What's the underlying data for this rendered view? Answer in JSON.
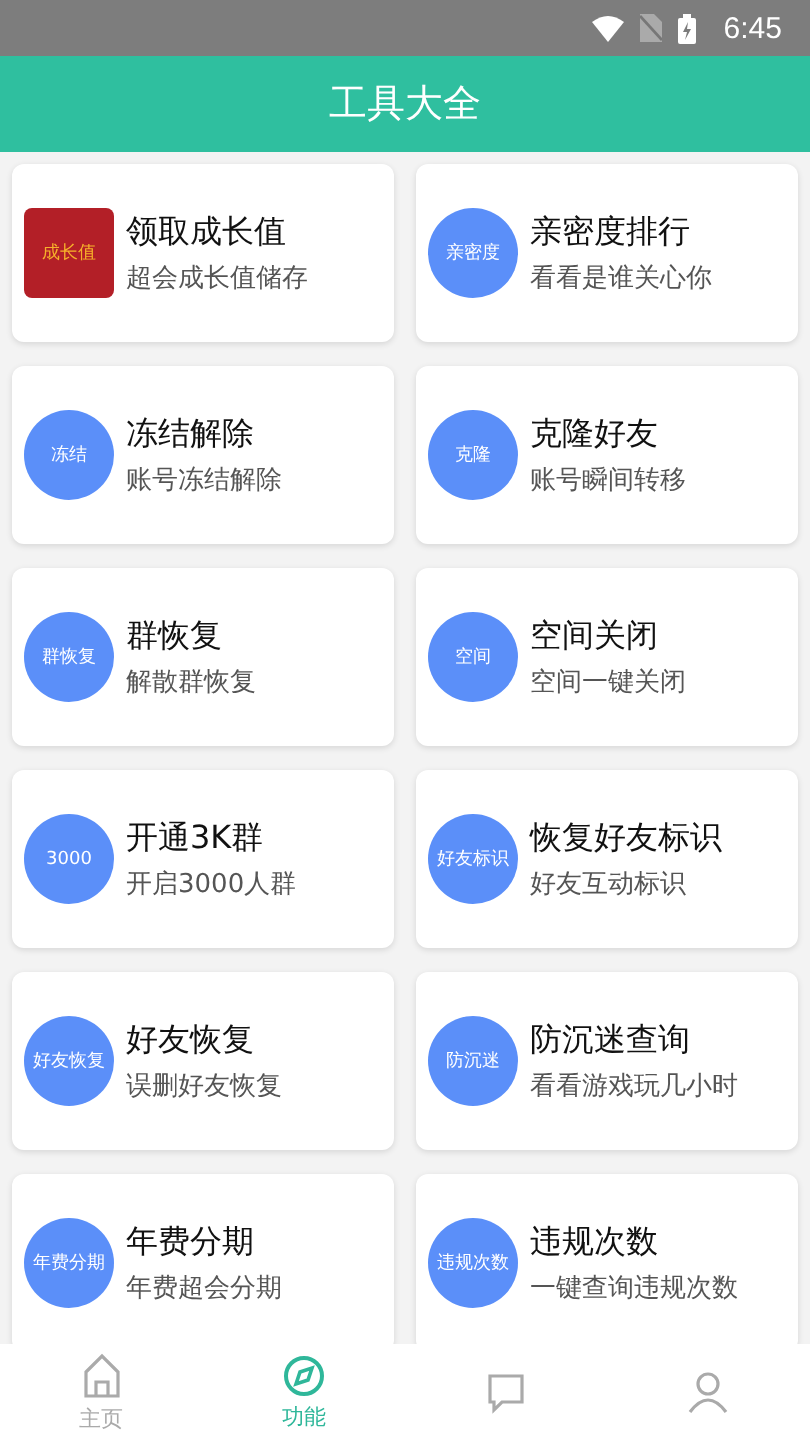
{
  "status_bar": {
    "time": "6:45"
  },
  "header": {
    "title": "工具大全"
  },
  "tools": [
    {
      "kind": "square",
      "icon_text": "成长值",
      "title": "领取成长值",
      "subtitle": "超会成长值储存"
    },
    {
      "kind": "circle",
      "icon_text": "亲密度",
      "title": "亲密度排行",
      "subtitle": "看看是谁关心你"
    },
    {
      "kind": "circle",
      "icon_text": "冻结",
      "title": "冻结解除",
      "subtitle": "账号冻结解除"
    },
    {
      "kind": "circle",
      "icon_text": "克隆",
      "title": "克隆好友",
      "subtitle": "账号瞬间转移"
    },
    {
      "kind": "circle",
      "icon_text": "群恢复",
      "title": "群恢复",
      "subtitle": "解散群恢复"
    },
    {
      "kind": "circle",
      "icon_text": "空间",
      "title": "空间关闭",
      "subtitle": "空间一键关闭"
    },
    {
      "kind": "circle",
      "icon_text": "3000",
      "title": "开通3K群",
      "subtitle": "开启3000人群"
    },
    {
      "kind": "circle",
      "icon_text": "好友标识",
      "title": "恢复好友标识",
      "subtitle": "好友互动标识"
    },
    {
      "kind": "circle",
      "icon_text": "好友恢复",
      "title": "好友恢复",
      "subtitle": "误删好友恢复"
    },
    {
      "kind": "circle",
      "icon_text": "防沉迷",
      "title": "防沉迷查询",
      "subtitle": "看看游戏玩几小时"
    },
    {
      "kind": "circle",
      "icon_text": "年费分期",
      "title": "年费分期",
      "subtitle": "年费超会分期"
    },
    {
      "kind": "circle",
      "icon_text": "违规次数",
      "title": "违规次数",
      "subtitle": "一键查询违规次数"
    }
  ],
  "nav": [
    {
      "kind": "home",
      "label": "主页",
      "selected": false
    },
    {
      "kind": "compass",
      "label": "功能",
      "selected": true
    },
    {
      "kind": "chat",
      "selected": false
    },
    {
      "kind": "person",
      "selected": false
    }
  ]
}
